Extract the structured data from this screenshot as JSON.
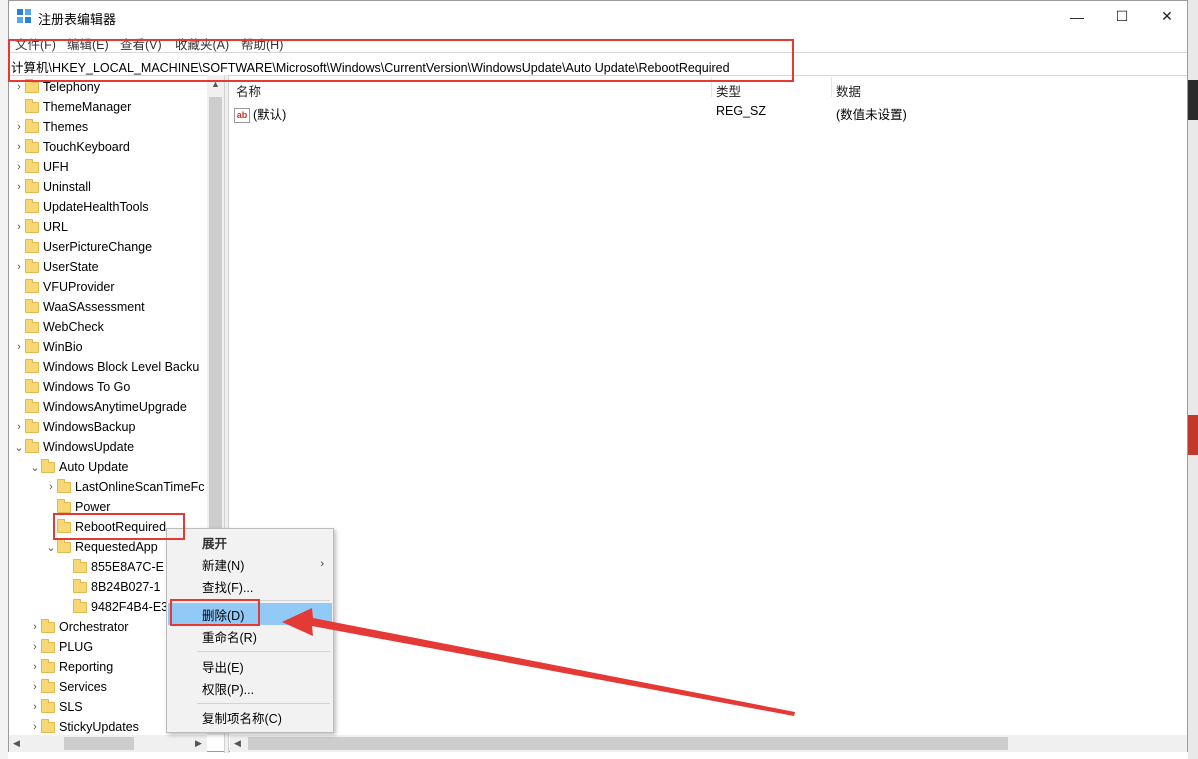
{
  "window": {
    "title": "注册表编辑器",
    "controls": {
      "minimize": "—",
      "maximize": "☐",
      "close": "✕"
    }
  },
  "menubar": {
    "items": [
      "文件(F)",
      "编辑(E)",
      "查看(V)",
      "收藏夹(A)",
      "帮助(H)"
    ]
  },
  "address": {
    "path": "计算机\\HKEY_LOCAL_MACHINE\\SOFTWARE\\Microsoft\\Windows\\CurrentVersion\\WindowsUpdate\\Auto Update\\RebootRequired"
  },
  "tree": {
    "items": [
      {
        "label": "Telephony",
        "depth": 0,
        "expander": "collapsed"
      },
      {
        "label": "ThemeManager",
        "depth": 0,
        "expander": "none"
      },
      {
        "label": "Themes",
        "depth": 0,
        "expander": "collapsed"
      },
      {
        "label": "TouchKeyboard",
        "depth": 0,
        "expander": "collapsed"
      },
      {
        "label": "UFH",
        "depth": 0,
        "expander": "collapsed"
      },
      {
        "label": "Uninstall",
        "depth": 0,
        "expander": "collapsed"
      },
      {
        "label": "UpdateHealthTools",
        "depth": 0,
        "expander": "none"
      },
      {
        "label": "URL",
        "depth": 0,
        "expander": "collapsed"
      },
      {
        "label": "UserPictureChange",
        "depth": 0,
        "expander": "none"
      },
      {
        "label": "UserState",
        "depth": 0,
        "expander": "collapsed"
      },
      {
        "label": "VFUProvider",
        "depth": 0,
        "expander": "none"
      },
      {
        "label": "WaaSAssessment",
        "depth": 0,
        "expander": "none"
      },
      {
        "label": "WebCheck",
        "depth": 0,
        "expander": "none"
      },
      {
        "label": "WinBio",
        "depth": 0,
        "expander": "collapsed"
      },
      {
        "label": "Windows Block Level Backu",
        "depth": 0,
        "expander": "none"
      },
      {
        "label": "Windows To Go",
        "depth": 0,
        "expander": "none"
      },
      {
        "label": "WindowsAnytimeUpgrade",
        "depth": 0,
        "expander": "none"
      },
      {
        "label": "WindowsBackup",
        "depth": 0,
        "expander": "collapsed"
      },
      {
        "label": "WindowsUpdate",
        "depth": 0,
        "expander": "expanded"
      },
      {
        "label": "Auto Update",
        "depth": 1,
        "expander": "expanded"
      },
      {
        "label": "LastOnlineScanTimeFc",
        "depth": 2,
        "expander": "collapsed"
      },
      {
        "label": "Power",
        "depth": 2,
        "expander": "none"
      },
      {
        "label": "RebootRequired",
        "depth": 2,
        "expander": "none",
        "selected": true
      },
      {
        "label": "RequestedApp",
        "depth": 2,
        "expander": "expanded"
      },
      {
        "label": "855E8A7C-E",
        "depth": 3,
        "expander": "none"
      },
      {
        "label": "8B24B027-1",
        "depth": 3,
        "expander": "none"
      },
      {
        "label": "9482F4B4-E3",
        "depth": 3,
        "expander": "none"
      },
      {
        "label": "Orchestrator",
        "depth": 1,
        "expander": "collapsed"
      },
      {
        "label": "PLUG",
        "depth": 1,
        "expander": "collapsed"
      },
      {
        "label": "Reporting",
        "depth": 1,
        "expander": "collapsed"
      },
      {
        "label": "Services",
        "depth": 1,
        "expander": "collapsed"
      },
      {
        "label": "SLS",
        "depth": 1,
        "expander": "collapsed"
      },
      {
        "label": "StickyUpdates",
        "depth": 1,
        "expander": "collapsed"
      }
    ]
  },
  "list": {
    "columns": {
      "name": "名称",
      "type": "类型",
      "data": "数据"
    },
    "rows": [
      {
        "icon": "ab",
        "name": "(默认)",
        "type": "REG_SZ",
        "data": "(数值未设置)"
      }
    ]
  },
  "context_menu": {
    "header": "展开",
    "new": "新建(N)",
    "new_arrow": "›",
    "find": "查找(F)...",
    "delete": "删除(D)",
    "rename": "重命名(R)",
    "export": "导出(E)",
    "permissions": "权限(P)...",
    "copy_key_name": "复制项名称(C)"
  },
  "icons": {
    "app": "registry-icon",
    "folder": "folder-icon",
    "string_value": "ab-string-icon"
  },
  "colors": {
    "annotation_red": "#e53935",
    "menu_highlight": "#91c9f7",
    "folder": "#f8d775"
  }
}
